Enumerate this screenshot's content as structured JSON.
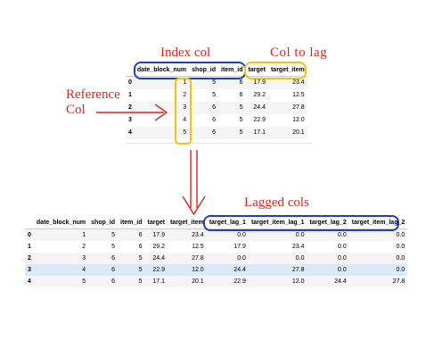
{
  "annotations": {
    "index_col": "Index col",
    "col_to_lag": "Col to lag",
    "reference_col": "Reference\nCol",
    "lagged_cols": "Lagged cols"
  },
  "colors": {
    "annotation_red": "#d9261c",
    "box_blue": "#1f3fbf",
    "box_yellow": "#f2c20f",
    "highlight_row": "#dce9f5"
  },
  "table1": {
    "columns": [
      "",
      "date_block_num",
      "shop_id",
      "item_id",
      "target",
      "target_item"
    ],
    "rows": [
      [
        "0",
        "1",
        "5",
        "6",
        "17.9",
        "23.4"
      ],
      [
        "1",
        "2",
        "5",
        "6",
        "29.2",
        "12.5"
      ],
      [
        "2",
        "3",
        "6",
        "5",
        "24.4",
        "27.8"
      ],
      [
        "3",
        "4",
        "6",
        "5",
        "22.9",
        "12.0"
      ],
      [
        "4",
        "5",
        "6",
        "5",
        "17.1",
        "20.1"
      ]
    ]
  },
  "table2": {
    "columns": [
      "",
      "date_block_num",
      "shop_id",
      "item_id",
      "target",
      "target_item",
      "target_lag_1",
      "target_item_lag_1",
      "target_lag_2",
      "target_item_lag_2"
    ],
    "rows": [
      [
        "0",
        "1",
        "5",
        "6",
        "17.9",
        "23.4",
        "0.0",
        "0.0",
        "0.0",
        "0.0"
      ],
      [
        "1",
        "2",
        "5",
        "6",
        "29.2",
        "12.5",
        "17.9",
        "23.4",
        "0.0",
        "0.0"
      ],
      [
        "2",
        "3",
        "6",
        "5",
        "24.4",
        "27.8",
        "0.0",
        "0.0",
        "0.0",
        "0.0"
      ],
      [
        "3",
        "4",
        "6",
        "5",
        "22.9",
        "12.0",
        "24.4",
        "27.8",
        "0.0",
        "0.0"
      ],
      [
        "4",
        "5",
        "6",
        "5",
        "17.1",
        "20.1",
        "22.9",
        "12.0",
        "24.4",
        "27.8"
      ]
    ],
    "highlighted_row": 3
  }
}
